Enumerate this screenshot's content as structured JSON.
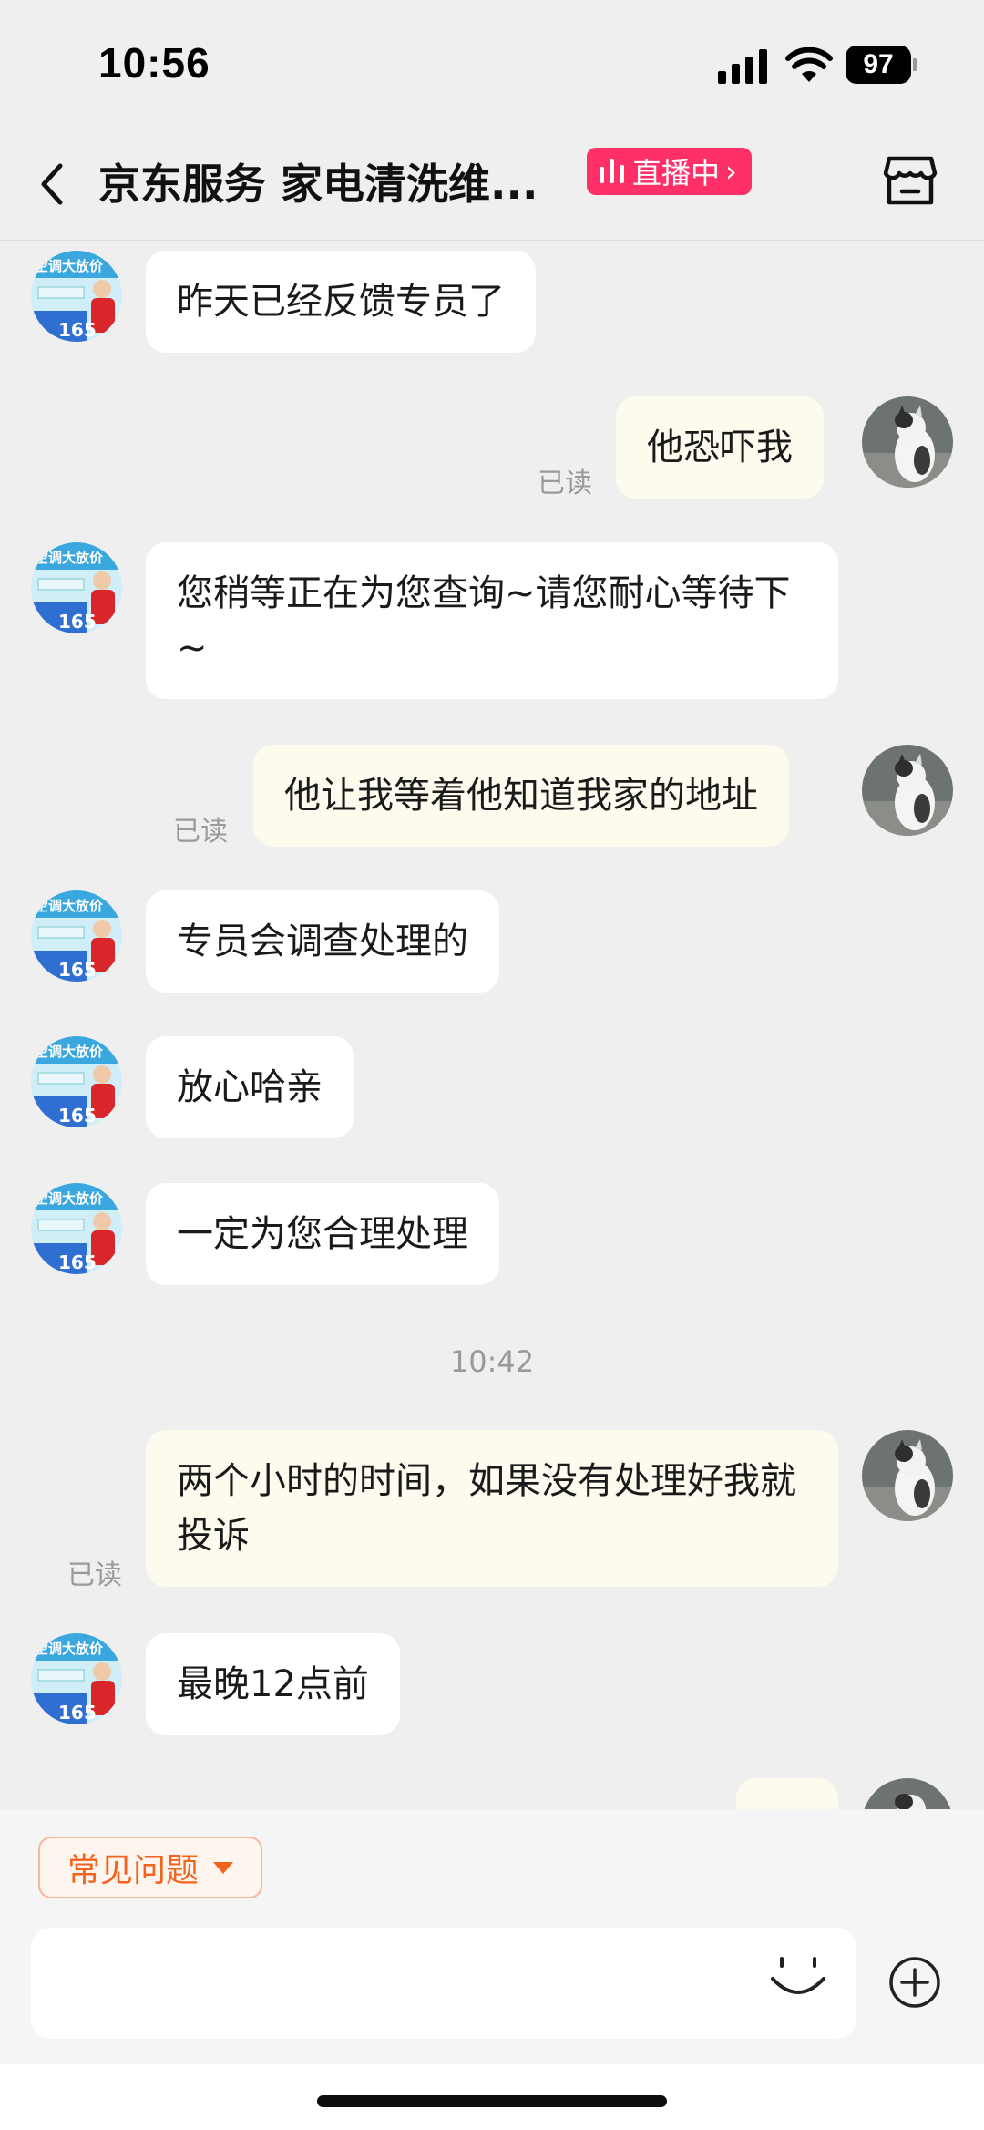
{
  "status_bar": {
    "time": "10:56",
    "battery": "97"
  },
  "header": {
    "title": "京东服务 家电清洗维...",
    "live_badge": "直播中",
    "back_icon": "chevron-left-icon",
    "store_icon": "store-icon"
  },
  "messages": [
    {
      "side": "in",
      "text": "昨天已经反馈专员了"
    },
    {
      "side": "out",
      "text": "他恐吓我",
      "status": "已读"
    },
    {
      "side": "in",
      "text": "您稍等正在为您查询~请您耐心等待下 ~"
    },
    {
      "side": "out",
      "text": "他让我等着他知道我家的地址",
      "status": "已读"
    },
    {
      "side": "in",
      "text": "专员会调查处理的"
    },
    {
      "side": "in",
      "text": "放心哈亲"
    },
    {
      "side": "in",
      "text": "一定为您合理处理"
    },
    {
      "side": "out",
      "text": "两个小时的时间，如果没有处理好我就投诉",
      "status": "已读"
    },
    {
      "side": "in",
      "text": "最晚12点前"
    }
  ],
  "time_separator": "10:42",
  "agent_avatar": {
    "badge_text": "空调大放价",
    "number": "165"
  },
  "quick_reply": {
    "label": "常见问题"
  },
  "input": {
    "placeholder": ""
  },
  "colors": {
    "live_badge": "#ff2f68",
    "faq_accent": "#f0641e",
    "outgoing_bubble": "#fdfbee",
    "incoming_bubble": "#ffffff"
  }
}
